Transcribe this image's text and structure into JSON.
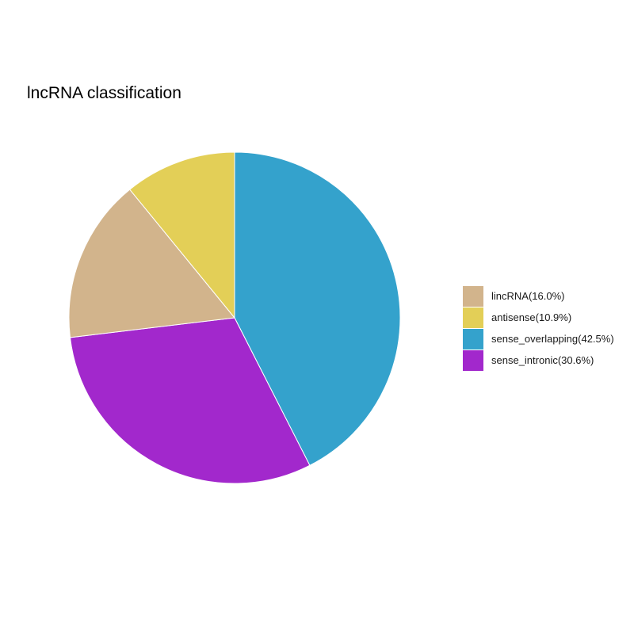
{
  "chart_data": {
    "type": "pie",
    "title": "lncRNA classification",
    "categories": [
      "lincRNA",
      "antisense",
      "sense_overlapping",
      "sense_intronic"
    ],
    "values": [
      16.0,
      10.9,
      42.5,
      30.6
    ],
    "legend_labels": [
      "lincRNA(16.0%)",
      "antisense(10.9%)",
      "sense_overlapping(42.5%)",
      "sense_intronic(30.6%)"
    ],
    "colors": [
      "#D2B48C",
      "#E3CF57",
      "#34A2CC",
      "#A228CC"
    ],
    "legend_position": "right"
  }
}
